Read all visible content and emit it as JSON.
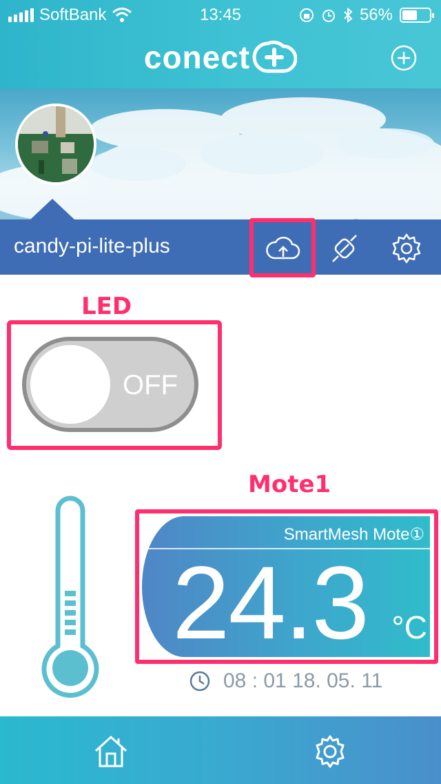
{
  "status_bar": {
    "carrier": "SoftBank",
    "time": "13:45",
    "battery": "56%",
    "battery_level": 0.56
  },
  "header": {
    "logo_text": "conect",
    "add_icon": "plus-circle-icon"
  },
  "device": {
    "name": "candy-pi-lite-plus",
    "icons": [
      "cloud-upload-icon",
      "link-icon",
      "gear-icon"
    ]
  },
  "annotations": {
    "led_label": "LED",
    "mote_label": "Mote1"
  },
  "led": {
    "state_label": "OFF",
    "on": false
  },
  "mote": {
    "title": "SmartMesh Mote①",
    "value": "24.3",
    "unit": "°C",
    "timestamp": "08 : 01 18. 05. 11"
  },
  "tabbar": {
    "items": [
      "home-icon",
      "gear-icon"
    ]
  },
  "colors": {
    "header": "#3ec2d4",
    "device_bar": "#3e6db5",
    "highlight": "#ff2f6e",
    "thermometer": "#5bbfd0"
  }
}
